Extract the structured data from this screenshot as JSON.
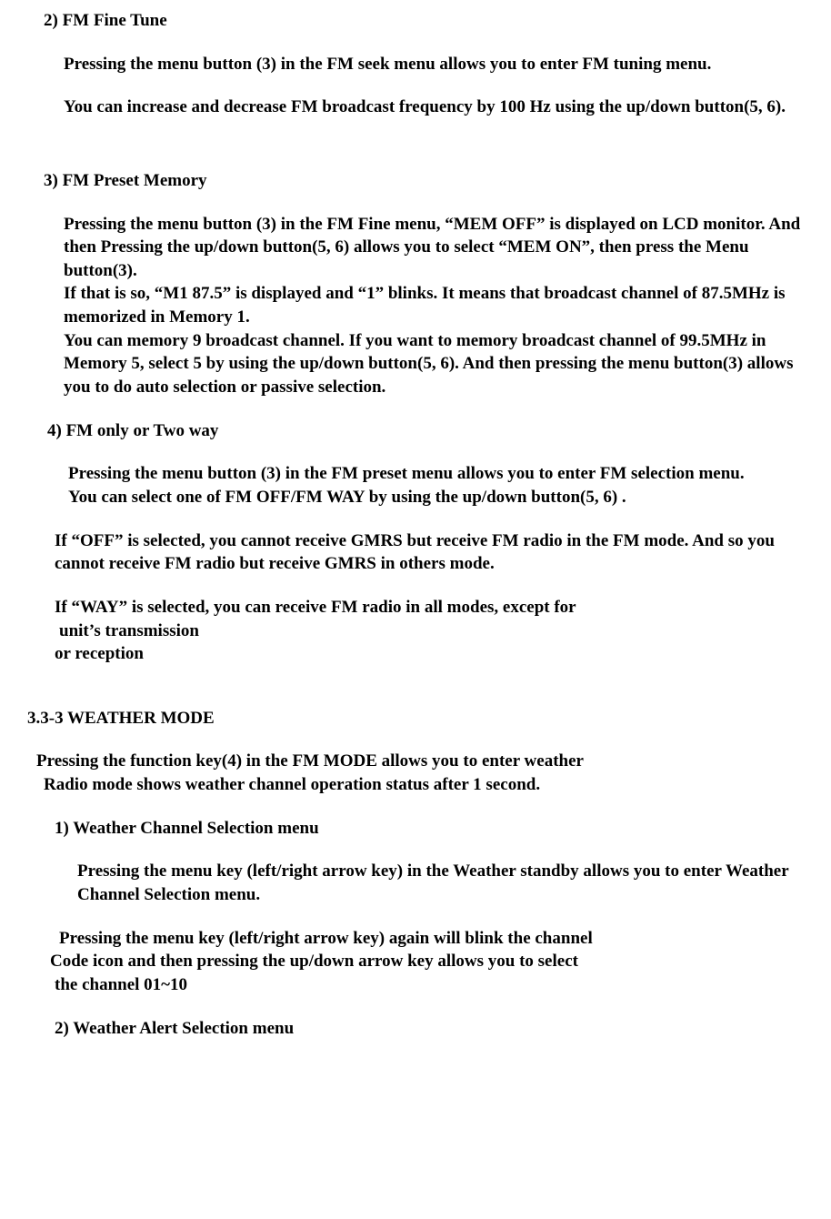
{
  "s2": {
    "head": "2)  FM Fine Tune",
    "p1": "Pressing the menu button (3) in the FM seek menu allows you to enter FM tuning menu.",
    "p2": "You can increase and decrease FM broadcast frequency by 100 Hz using the up/down button(5, 6)."
  },
  "s3": {
    "head": "3)  FM Preset Memory",
    "p1": "Pressing the menu button (3) in the FM Fine menu, “MEM OFF” is displayed on LCD monitor. And then Pressing the up/down button(5, 6) allows you to select “MEM ON”, then press the Menu button(3).",
    "p2": "If that is so, “M1 87.5” is displayed and  “1” blinks. It means that broadcast channel of 87.5MHz is memorized in Memory 1.",
    "p3": "You can memory 9 broadcast channel. If you want to memory broadcast channel of 99.5MHz in Memory 5, select 5 by using the up/down button(5, 6). And then pressing the menu button(3) allows you to do auto selection or passive selection."
  },
  "s4": {
    "head": "4)  FM only or Two way",
    "p1": "Pressing the menu button (3) in the FM preset menu allows you to enter FM selection menu.",
    "p2": "You can select one of FM OFF/FM WAY by using the up/down button(5, 6) .",
    "p3": "If “OFF” is selected, you cannot receive GMRS but receive FM radio in the FM mode. And so you cannot receive FM radio but receive GMRS in others mode.",
    "p4a": "If “WAY” is selected, you can receive FM radio in all modes, except for",
    "p4b": " unit’s transmission",
    "p4c": "or reception"
  },
  "weather": {
    "head": "3.3-3         WEATHER MODE",
    "intro1": "Pressing the function key(4) in the FM MODE allows you to enter weather",
    "intro2": "Radio mode shows weather channel operation status after 1 second.",
    "w1head": "1)   Weather Channel Selection menu",
    "w1p1": "Pressing the menu key (left/right arrow key) in the Weather standby allows you to enter Weather Channel Selection menu.",
    "w1p2a": "Pressing the menu key (left/right arrow key) again will blink the channel",
    "w1p2b": "Code icon and then pressing the up/down arrow key allows you to select",
    "w1p2c": " the channel 01~10",
    "w2head": "2)   Weather Alert Selection menu"
  }
}
